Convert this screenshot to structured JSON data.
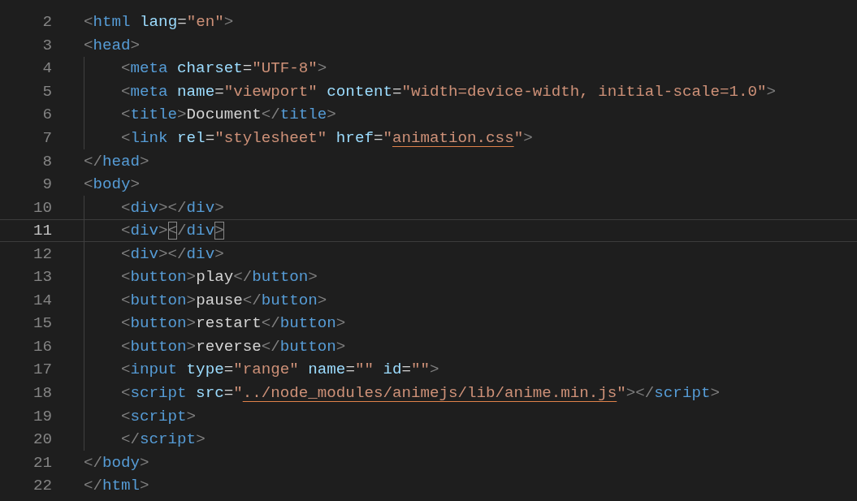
{
  "editor": {
    "lines": [
      {
        "number": "2",
        "current": false,
        "tokens": [
          {
            "text": "<",
            "kind": "punct"
          },
          {
            "text": "html",
            "kind": "tag"
          },
          {
            "text": " lang",
            "kind": "attr"
          },
          {
            "text": "=",
            "kind": "text"
          },
          {
            "text": "\"en\"",
            "kind": "string"
          },
          {
            "text": ">",
            "kind": "punct"
          }
        ]
      },
      {
        "number": "3",
        "current": false,
        "tokens": [
          {
            "text": "<",
            "kind": "punct"
          },
          {
            "text": "head",
            "kind": "tag"
          },
          {
            "text": ">",
            "kind": "punct"
          }
        ],
        "children": [
          {
            "number": "4",
            "current": false,
            "tokens": [
              {
                "text": "<",
                "kind": "punct"
              },
              {
                "text": "meta",
                "kind": "tag"
              },
              {
                "text": " charset",
                "kind": "attr"
              },
              {
                "text": "=",
                "kind": "text"
              },
              {
                "text": "\"UTF-8\"",
                "kind": "string"
              },
              {
                "text": ">",
                "kind": "punct"
              }
            ]
          },
          {
            "number": "5",
            "current": false,
            "tokens": [
              {
                "text": "<",
                "kind": "punct"
              },
              {
                "text": "meta",
                "kind": "tag"
              },
              {
                "text": " name",
                "kind": "attr"
              },
              {
                "text": "=",
                "kind": "text"
              },
              {
                "text": "\"viewport\"",
                "kind": "string"
              },
              {
                "text": " content",
                "kind": "attr"
              },
              {
                "text": "=",
                "kind": "text"
              },
              {
                "text": "\"width=device-width, initial-scale=1.0\"",
                "kind": "string"
              },
              {
                "text": ">",
                "kind": "punct"
              }
            ]
          },
          {
            "number": "6",
            "current": false,
            "tokens": [
              {
                "text": "<",
                "kind": "punct"
              },
              {
                "text": "title",
                "kind": "tag"
              },
              {
                "text": ">",
                "kind": "punct"
              },
              {
                "text": "Document",
                "kind": "text"
              },
              {
                "text": "</",
                "kind": "punct"
              },
              {
                "text": "title",
                "kind": "tag"
              },
              {
                "text": ">",
                "kind": "punct"
              }
            ]
          },
          {
            "number": "7",
            "current": false,
            "tokens": [
              {
                "text": "<",
                "kind": "punct"
              },
              {
                "text": "link",
                "kind": "tag"
              },
              {
                "text": " rel",
                "kind": "attr"
              },
              {
                "text": "=",
                "kind": "text"
              },
              {
                "text": "\"stylesheet\"",
                "kind": "string"
              },
              {
                "text": " href",
                "kind": "attr"
              },
              {
                "text": "=",
                "kind": "text"
              },
              {
                "text": "\"",
                "kind": "string"
              },
              {
                "text": "animation.css",
                "kind": "string",
                "link": true
              },
              {
                "text": "\"",
                "kind": "string"
              },
              {
                "text": ">",
                "kind": "punct"
              }
            ]
          }
        ]
      },
      {
        "number": "8",
        "current": false,
        "tokens": [
          {
            "text": "</",
            "kind": "punct"
          },
          {
            "text": "head",
            "kind": "tag"
          },
          {
            "text": ">",
            "kind": "punct"
          }
        ]
      },
      {
        "number": "9",
        "current": false,
        "tokens": [
          {
            "text": "<",
            "kind": "punct"
          },
          {
            "text": "body",
            "kind": "tag"
          },
          {
            "text": ">",
            "kind": "punct"
          }
        ],
        "children": [
          {
            "number": "10",
            "current": false,
            "tokens": [
              {
                "text": "<",
                "kind": "punct"
              },
              {
                "text": "div",
                "kind": "tag"
              },
              {
                "text": "></",
                "kind": "punct"
              },
              {
                "text": "div",
                "kind": "tag"
              },
              {
                "text": ">",
                "kind": "punct"
              }
            ]
          },
          {
            "number": "11",
            "current": true,
            "tokens": [
              {
                "text": "<",
                "kind": "punct"
              },
              {
                "text": "div",
                "kind": "tag"
              },
              {
                "text": ">",
                "kind": "punct"
              },
              {
                "text": "<",
                "kind": "punct",
                "matched": true
              },
              {
                "text": "/",
                "kind": "punct"
              },
              {
                "text": "div",
                "kind": "tag"
              },
              {
                "text": ">",
                "kind": "punct",
                "matched": true
              }
            ]
          },
          {
            "number": "12",
            "current": false,
            "tokens": [
              {
                "text": "<",
                "kind": "punct"
              },
              {
                "text": "div",
                "kind": "tag"
              },
              {
                "text": "></",
                "kind": "punct"
              },
              {
                "text": "div",
                "kind": "tag"
              },
              {
                "text": ">",
                "kind": "punct"
              }
            ]
          },
          {
            "number": "13",
            "current": false,
            "tokens": [
              {
                "text": "<",
                "kind": "punct"
              },
              {
                "text": "button",
                "kind": "tag"
              },
              {
                "text": ">",
                "kind": "punct"
              },
              {
                "text": "play",
                "kind": "text"
              },
              {
                "text": "</",
                "kind": "punct"
              },
              {
                "text": "button",
                "kind": "tag"
              },
              {
                "text": ">",
                "kind": "punct"
              }
            ]
          },
          {
            "number": "14",
            "current": false,
            "tokens": [
              {
                "text": "<",
                "kind": "punct"
              },
              {
                "text": "button",
                "kind": "tag"
              },
              {
                "text": ">",
                "kind": "punct"
              },
              {
                "text": "pause",
                "kind": "text"
              },
              {
                "text": "</",
                "kind": "punct"
              },
              {
                "text": "button",
                "kind": "tag"
              },
              {
                "text": ">",
                "kind": "punct"
              }
            ]
          },
          {
            "number": "15",
            "current": false,
            "tokens": [
              {
                "text": "<",
                "kind": "punct"
              },
              {
                "text": "button",
                "kind": "tag"
              },
              {
                "text": ">",
                "kind": "punct"
              },
              {
                "text": "restart",
                "kind": "text"
              },
              {
                "text": "</",
                "kind": "punct"
              },
              {
                "text": "button",
                "kind": "tag"
              },
              {
                "text": ">",
                "kind": "punct"
              }
            ]
          },
          {
            "number": "16",
            "current": false,
            "tokens": [
              {
                "text": "<",
                "kind": "punct"
              },
              {
                "text": "button",
                "kind": "tag"
              },
              {
                "text": ">",
                "kind": "punct"
              },
              {
                "text": "reverse",
                "kind": "text"
              },
              {
                "text": "</",
                "kind": "punct"
              },
              {
                "text": "button",
                "kind": "tag"
              },
              {
                "text": ">",
                "kind": "punct"
              }
            ]
          },
          {
            "number": "17",
            "current": false,
            "tokens": [
              {
                "text": "<",
                "kind": "punct"
              },
              {
                "text": "input",
                "kind": "tag"
              },
              {
                "text": " type",
                "kind": "attr"
              },
              {
                "text": "=",
                "kind": "text"
              },
              {
                "text": "\"range\"",
                "kind": "string"
              },
              {
                "text": " name",
                "kind": "attr"
              },
              {
                "text": "=",
                "kind": "text"
              },
              {
                "text": "\"\"",
                "kind": "string"
              },
              {
                "text": " id",
                "kind": "attr"
              },
              {
                "text": "=",
                "kind": "text"
              },
              {
                "text": "\"\"",
                "kind": "string"
              },
              {
                "text": ">",
                "kind": "punct"
              }
            ]
          },
          {
            "number": "18",
            "current": false,
            "tokens": [
              {
                "text": "<",
                "kind": "punct"
              },
              {
                "text": "script",
                "kind": "tag"
              },
              {
                "text": " src",
                "kind": "attr"
              },
              {
                "text": "=",
                "kind": "text"
              },
              {
                "text": "\"",
                "kind": "string"
              },
              {
                "text": "../node_modules/animejs/lib/anime.min.js",
                "kind": "string",
                "link": true
              },
              {
                "text": "\"",
                "kind": "string"
              },
              {
                "text": "></",
                "kind": "punct"
              },
              {
                "text": "script",
                "kind": "tag"
              },
              {
                "text": ">",
                "kind": "punct"
              }
            ]
          },
          {
            "number": "19",
            "current": false,
            "tokens": [
              {
                "text": "<",
                "kind": "punct"
              },
              {
                "text": "script",
                "kind": "tag"
              },
              {
                "text": ">",
                "kind": "punct"
              }
            ]
          },
          {
            "number": "20",
            "current": false,
            "tokens": [
              {
                "text": "</",
                "kind": "punct"
              },
              {
                "text": "script",
                "kind": "tag"
              },
              {
                "text": ">",
                "kind": "punct"
              }
            ]
          }
        ]
      },
      {
        "number": "21",
        "current": false,
        "tokens": [
          {
            "text": "</",
            "kind": "punct"
          },
          {
            "text": "body",
            "kind": "tag"
          },
          {
            "text": ">",
            "kind": "punct"
          }
        ]
      },
      {
        "number": "22",
        "current": false,
        "tokens": [
          {
            "text": "</",
            "kind": "punct"
          },
          {
            "text": "html",
            "kind": "tag"
          },
          {
            "text": ">",
            "kind": "punct"
          }
        ]
      }
    ]
  }
}
